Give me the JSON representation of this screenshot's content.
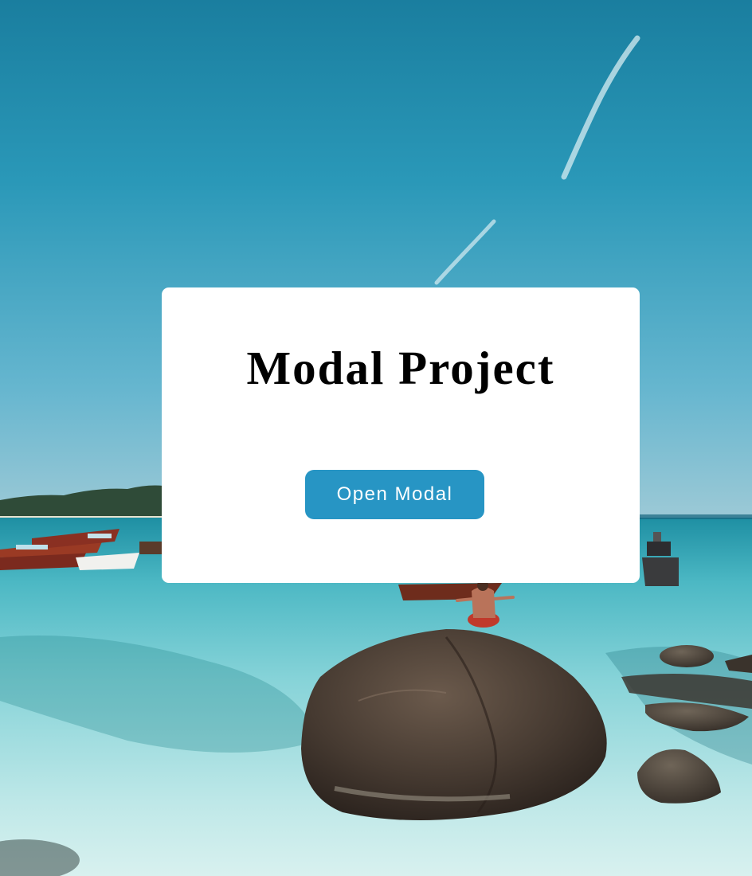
{
  "page": {
    "title": "Modal Project"
  },
  "modal_trigger": {
    "label": "Open Modal"
  },
  "background": {
    "scene": "beach-photo",
    "sky_color": "#1e86a8",
    "water_color": "#7fd4dc"
  },
  "theme": {
    "card_bg": "#ffffff",
    "button_bg": "#2795c4",
    "button_text": "#ffffff",
    "title_color": "#000000"
  }
}
